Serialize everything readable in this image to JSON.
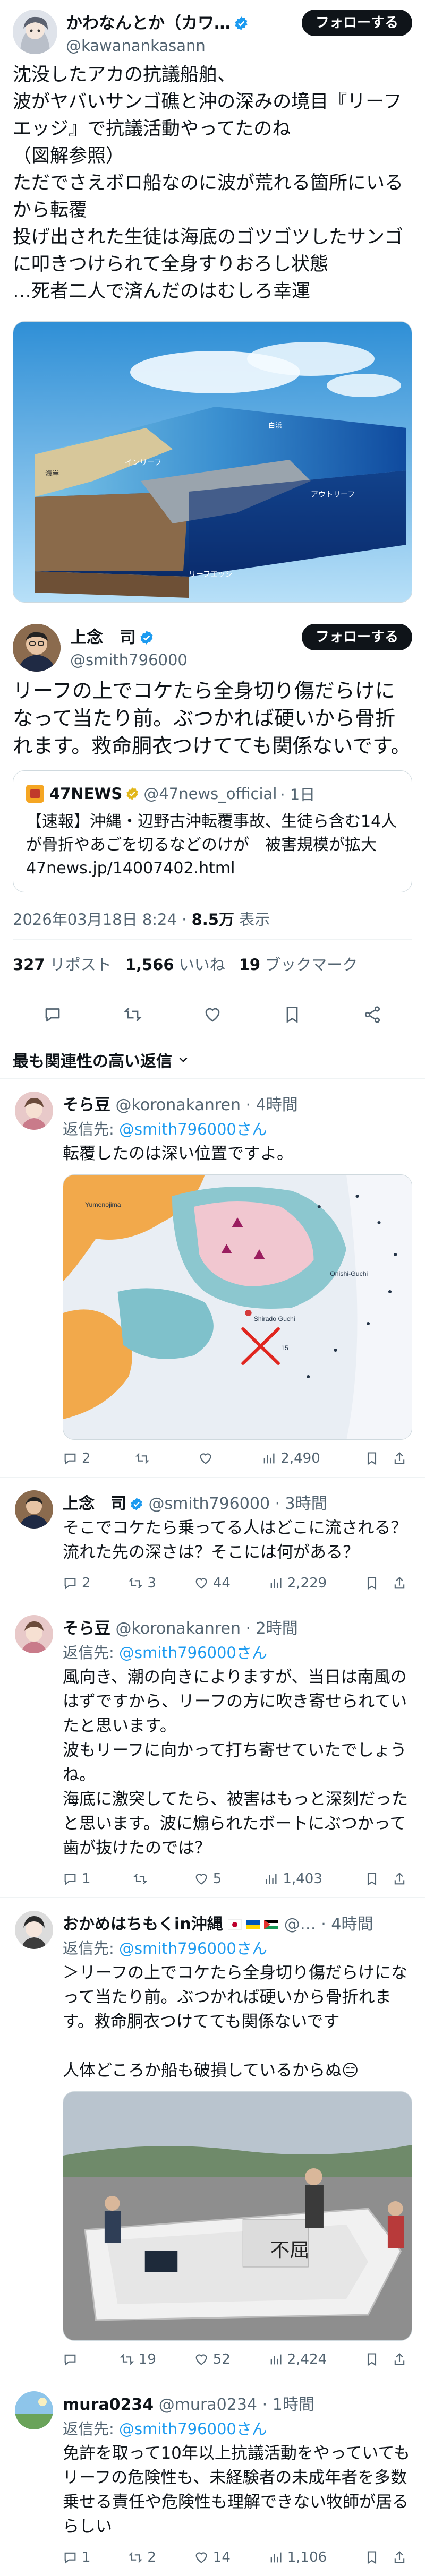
{
  "top_tweet": {
    "name": "かわなんとか（カワ…",
    "handle": "@kawanankasann",
    "follow_label": "フォローする",
    "text": "沈没したアカの抗議船舶、\n波がヤバいサンゴ礁と沖の深みの境目『リーフエッジ』で抗議活動やってたのね\n（図解参照）\nただでさえボロ船なのに波が荒れる箇所にいるから転覆\n投げ出された生徒は海底のゴツゴツしたサンゴに叩きつけられて全身すりおろし状態\n…死者二人で済んだのはむしろ幸運",
    "diagram_labels": {
      "inner_reef": "インリーフ",
      "outer_reef": "アウトリーフ",
      "reef_edge": "リーフエッジ",
      "shore": "海岸",
      "sandy": "白浜"
    }
  },
  "main_tweet": {
    "name": "上念　司",
    "handle": "@smith796000",
    "follow_label": "フォローする",
    "text": "リーフの上でコケたら全身切り傷だらけになって当たり前。ぶつかれば硬いから骨折れます。救命胴衣つけてても関係ないです。",
    "quote": {
      "source_name": "47NEWS",
      "source_handle": "@47news_official",
      "time": "· 1日",
      "text": "【速報】沖縄・辺野古沖転覆事故、生徒ら含む14人が骨折やあごを切るなどのけが　被害規模が拡大 47news.jp/14007402.html"
    },
    "timestamp": "2026年03月18日 8:24 · ",
    "views": "8.5万",
    "views_label": " 表示",
    "reposts": "327",
    "reposts_label": " リポスト",
    "likes": "1,566",
    "likes_label": " いいね",
    "bookmarks": "19",
    "bookmarks_label": " ブックマーク"
  },
  "sort_label": "最も関連性の高い返信",
  "replies": [
    {
      "name": "そら豆",
      "handle": "@koronakanren",
      "time": "· 4時間",
      "reply_to_prefix": "返信先: ",
      "reply_to": "@smith796000さん",
      "text": "転覆したのは深い位置ですよ。",
      "map_labels": [
        "Shirado Guchi",
        "Onishi-Guchi",
        "Yumenojima",
        "15"
      ],
      "replies": "2",
      "reposts": "",
      "likes": "",
      "views": "2,490"
    },
    {
      "name": "上念　司",
      "handle": "@smith796000",
      "time": "· 3時間",
      "reply_to_prefix": "",
      "reply_to": "",
      "text": "そこでコケたら乗ってる人はどこに流される？流れた先の深さは？そこには何がある？",
      "replies": "2",
      "reposts": "3",
      "likes": "44",
      "views": "2,229"
    },
    {
      "name": "そら豆",
      "handle": "@koronakanren",
      "time": "· 2時間",
      "reply_to_prefix": "返信先: ",
      "reply_to": "@smith796000さん",
      "text": "風向き、潮の向きによりますが、当日は南風のはずですから、リーフの方に吹き寄せられていたと思います。\n波もリーフに向かって打ち寄せていたでしょうね。\n海底に激突してたら、被害はもっと深刻だったと思います。波に煽られたボートにぶつかって歯が抜けたのでは？",
      "replies": "1",
      "reposts": "",
      "likes": "5",
      "views": "1,403"
    },
    {
      "name": "おかめはちもくin沖縄",
      "handle": "@…",
      "time": "· 4時間",
      "reply_to_prefix": "返信先: ",
      "reply_to": "@smith796000さん",
      "text": "＞リーフの上でコケたら全身切り傷だらけになって当たり前。ぶつかれば硬いから骨折れます。救命胴衣つけてても関係ないです\n\n人体どころか船も破損しているからぬ😑",
      "boat_label": "不屈",
      "replies": "",
      "reposts": "19",
      "likes": "52",
      "views": "2,424"
    },
    {
      "name": "mura0234",
      "handle": "@mura0234",
      "time": "· 1時間",
      "reply_to_prefix": "返信先: ",
      "reply_to": "@smith796000さん",
      "text": "免許を取って10年以上抗議活動をやっていてもリーフの危険性も、未経験者の未成年者を多数乗せる責任や危険性も理解できない牧師が居るらしい",
      "replies": "1",
      "reposts": "2",
      "likes": "14",
      "views": "1,106"
    }
  ],
  "colors": {
    "accent": "#1d9bf0",
    "text": "#0f1419",
    "muted": "#536471",
    "border": "#cfd9de"
  }
}
